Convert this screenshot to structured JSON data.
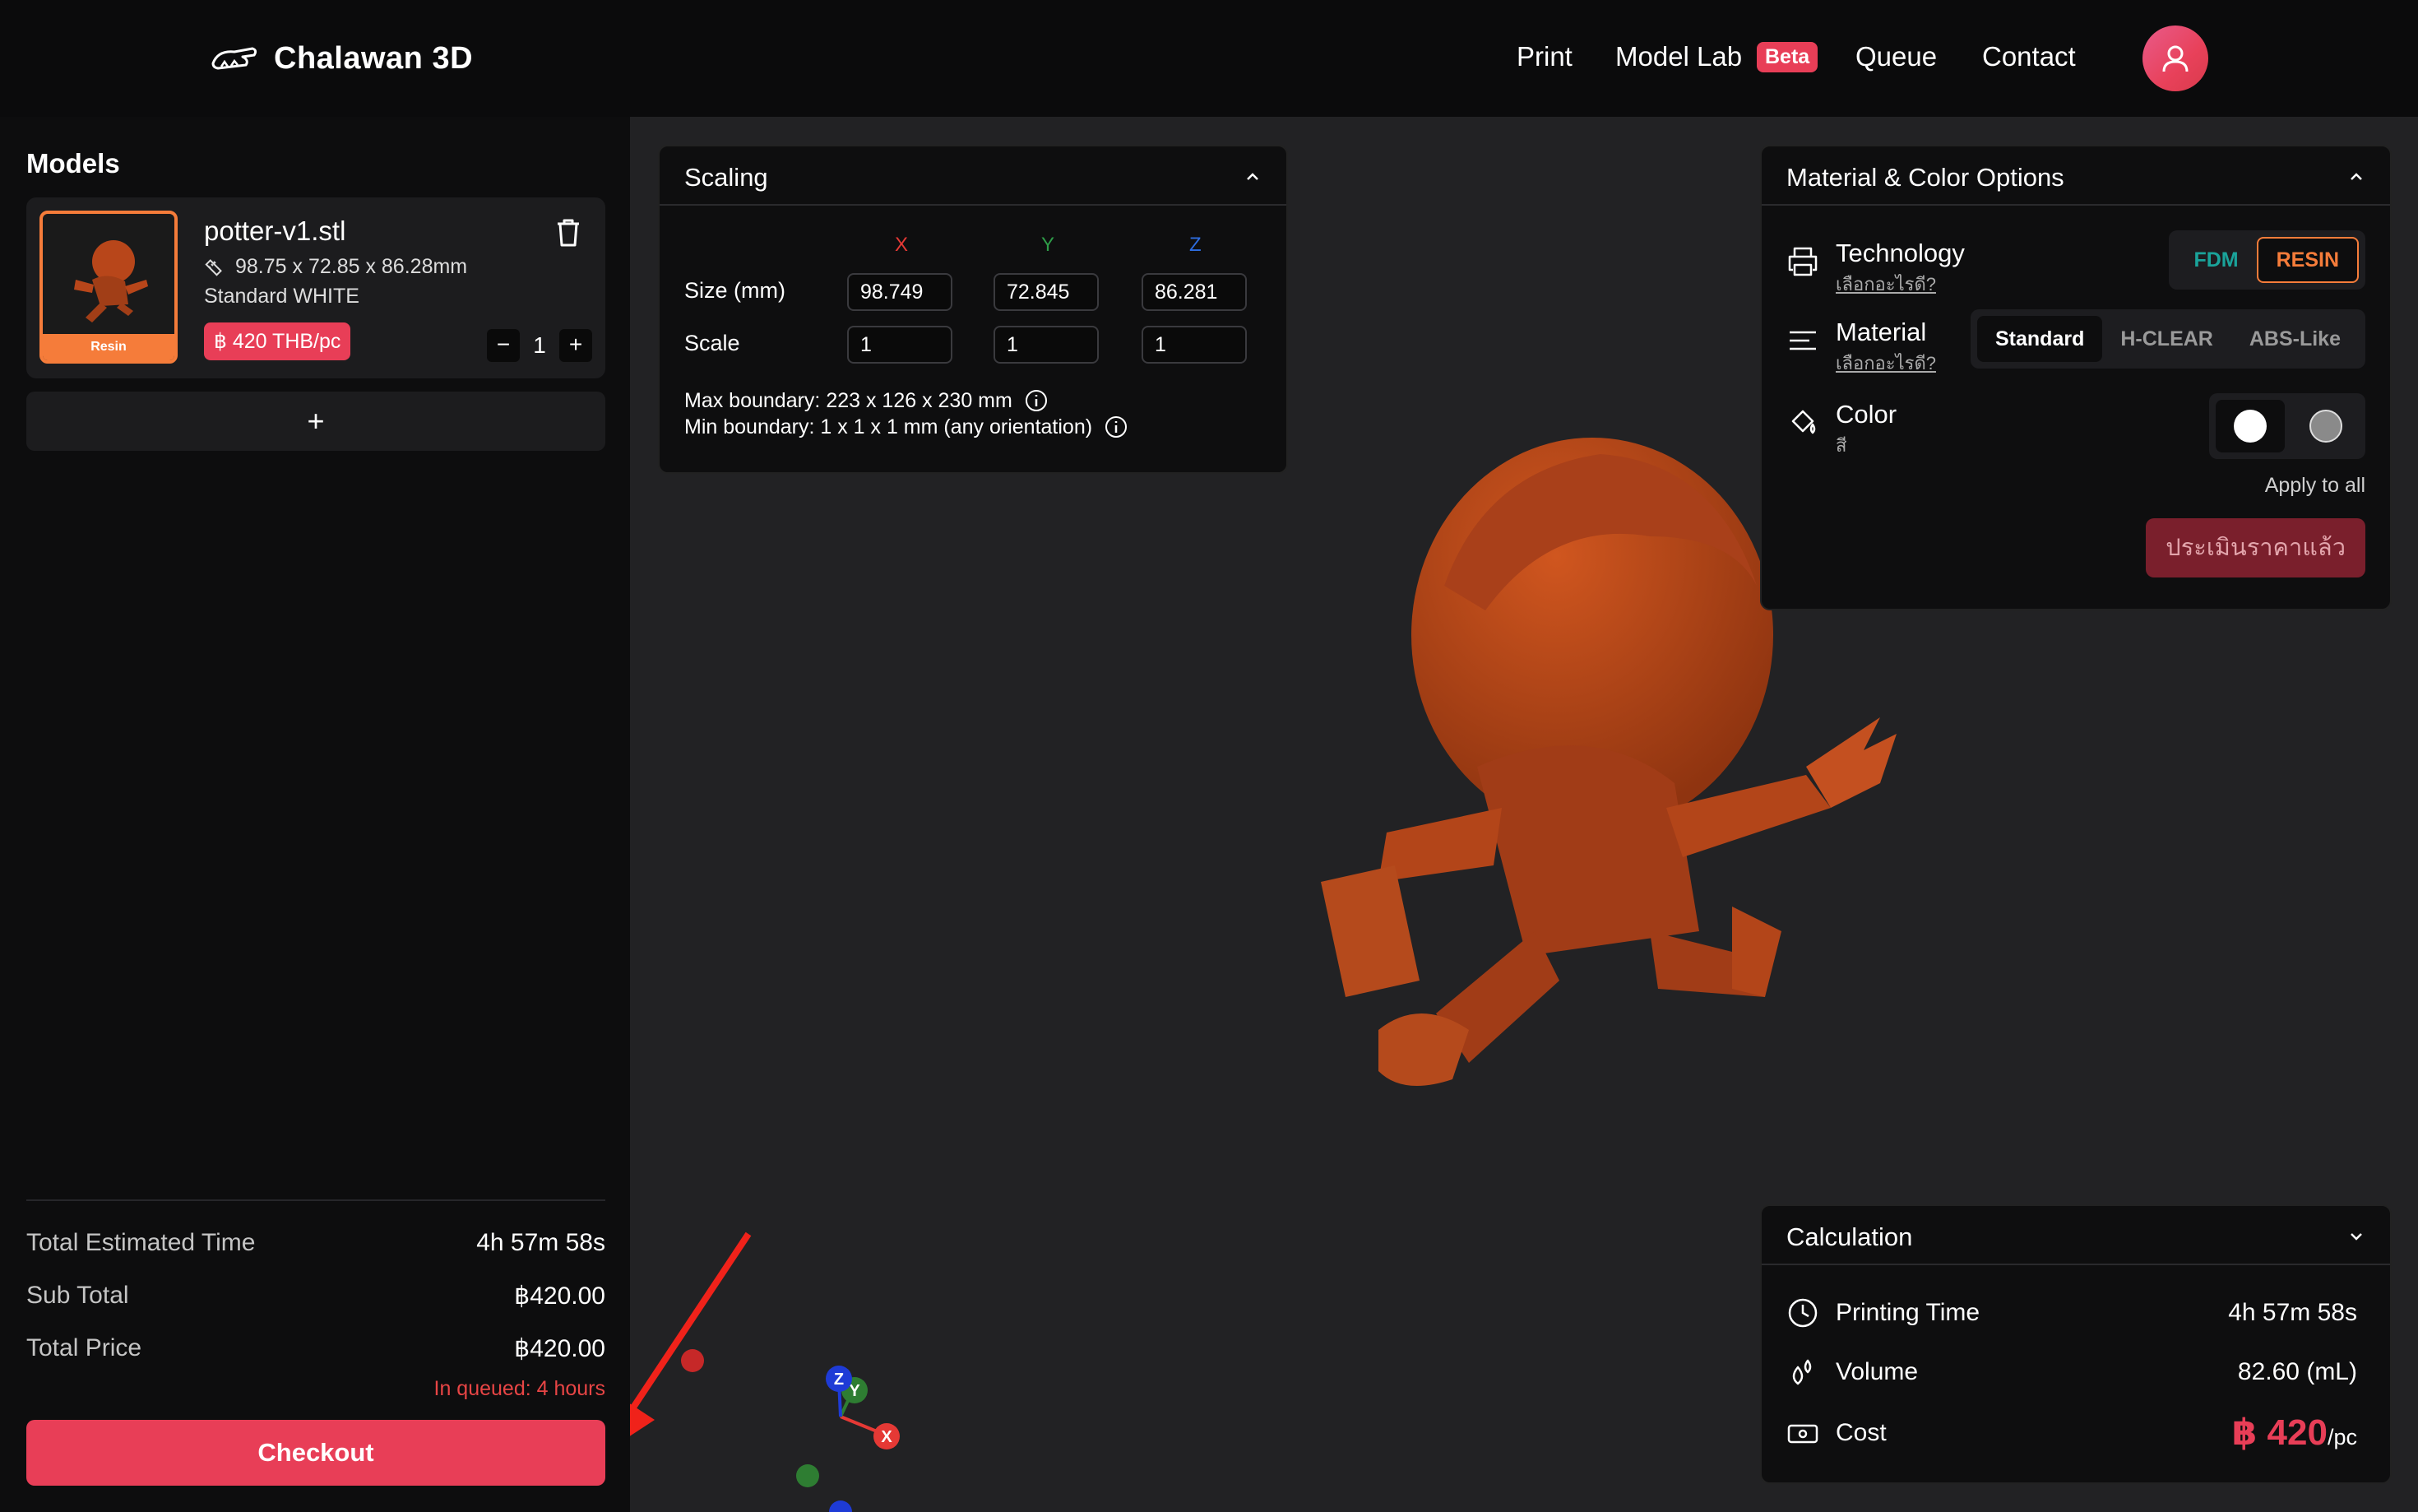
{
  "brand": {
    "name": "Chalawan 3D"
  },
  "nav": {
    "print": "Print",
    "model_lab": "Model Lab",
    "model_lab_badge": "Beta",
    "queue": "Queue",
    "contact": "Contact"
  },
  "sidebar": {
    "title": "Models",
    "models": [
      {
        "name": "potter-v1.stl",
        "dimensions": "98.75 x 72.85 x 86.28mm",
        "material": "Standard WHITE",
        "tech_label": "Resin",
        "price": "฿ 420 THB/pc",
        "quantity": "1"
      }
    ],
    "add_label": "+",
    "summary": {
      "time_label": "Total Estimated Time",
      "time_value": "4h 57m 58s",
      "subtotal_label": "Sub Total",
      "subtotal_value": "฿420.00",
      "total_label": "Total Price",
      "total_value": "฿420.00",
      "queue_note": "In queued: 4 hours"
    },
    "checkout_label": "Checkout"
  },
  "scaling": {
    "title": "Scaling",
    "axes": [
      "X",
      "Y",
      "Z"
    ],
    "size_label": "Size (mm)",
    "size_values": [
      "98.749",
      "72.845",
      "86.281"
    ],
    "scale_label": "Scale",
    "scale_values": [
      "1",
      "1",
      "1"
    ],
    "max_boundary": "Max boundary: 223 x 126 x 230 mm",
    "min_boundary": "Min boundary: 1 x 1 x 1 mm (any orientation)"
  },
  "material_panel": {
    "title": "Material & Color Options",
    "technology_label": "Technology",
    "technology_sub": "เลือกอะไรดี?",
    "tech_options": [
      "FDM",
      "RESIN"
    ],
    "tech_selected": "RESIN",
    "material_label": "Material",
    "material_sub": "เลือกอะไรดี?",
    "material_options": [
      "Standard",
      "H-CLEAR",
      "ABS-Like"
    ],
    "material_selected": "Standard",
    "color_label": "Color",
    "color_sub": "สี",
    "colors": [
      "#ffffff",
      "#8a8a8a"
    ],
    "apply_all": "Apply to all",
    "estimate_button": "ประเมินราคาแล้ว"
  },
  "calculation": {
    "title": "Calculation",
    "printing_time_label": "Printing Time",
    "printing_time_value": "4h 57m 58s",
    "volume_label": "Volume",
    "volume_value": "82.60 (mL)",
    "cost_label": "Cost",
    "cost_value": "฿ 420",
    "cost_unit": "/pc"
  },
  "gizmo": {
    "x": "X",
    "y": "Y",
    "z": "Z"
  },
  "colors": {
    "accent": "#e83e57",
    "resin_orange": "#f57c3a",
    "fdm_teal": "#1aa39a",
    "model_color": "#b8461a",
    "axis_x": "#e53935",
    "axis_y": "#2e7d32",
    "axis_z": "#1e3bd6"
  }
}
